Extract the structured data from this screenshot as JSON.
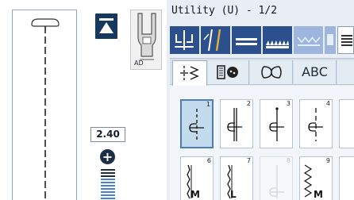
{
  "screen": {
    "title": "Utility (U) - 1/2",
    "presser_foot": "AD",
    "stitch_width": "2.40",
    "tabs": [
      {
        "id": "utility",
        "icon": "utility-stitch-icon",
        "active": true
      },
      {
        "id": "buttonhole",
        "icon": "buttonhole-icon",
        "active": false
      },
      {
        "id": "decorative",
        "icon": "decorative-stitch-icon",
        "active": false
      },
      {
        "id": "letters",
        "label": "ABC",
        "active": false
      },
      {
        "id": "more",
        "icon": "more-tabs-icon",
        "active": false
      }
    ],
    "tools": [
      {
        "icon": "mirror-stitch-icon",
        "enabled": true
      },
      {
        "icon": "twin-needle-icon",
        "enabled": true
      },
      {
        "icon": "stitch-length-icon",
        "enabled": true
      },
      {
        "icon": "feed-dog-icon",
        "enabled": true
      },
      {
        "icon": "elongation-icon",
        "enabled": false
      },
      {
        "icon": "presser-foot-icon",
        "enabled": false
      },
      {
        "icon": "keyboard-icon",
        "enabled": true
      }
    ],
    "stitches": [
      {
        "number": "1",
        "letter": "",
        "selected": true,
        "enabled": true
      },
      {
        "number": "2",
        "letter": "",
        "selected": false,
        "enabled": true
      },
      {
        "number": "3",
        "letter": "",
        "selected": false,
        "enabled": true
      },
      {
        "number": "4",
        "letter": "",
        "selected": false,
        "enabled": true
      },
      {
        "number": "6",
        "letter": "M",
        "selected": false,
        "enabled": true
      },
      {
        "number": "7",
        "letter": "L",
        "selected": false,
        "enabled": true
      },
      {
        "number": "8",
        "letter": "",
        "selected": false,
        "enabled": false
      },
      {
        "number": "9",
        "letter": "M",
        "selected": false,
        "enabled": true
      }
    ],
    "colors": {
      "accent_dark": "#2c4f8e",
      "accent_disabled": "#9eb6dd",
      "selected_tile": "#c4dbee",
      "panel_bg": "#e8eef4",
      "preview_border": "#8aa6c2",
      "width_bar": "#4a82c6"
    }
  }
}
